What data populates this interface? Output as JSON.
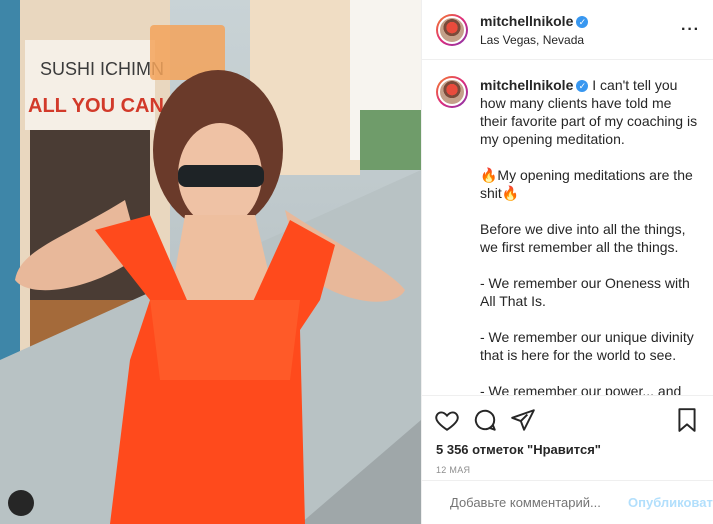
{
  "post": {
    "username": "mitchellnikole",
    "location": "Las Vegas, Nevada",
    "caption": "I can't tell you how many clients have told me their favorite part of my coaching is my opening meditation.\n\n🔥My opening meditations are the shit🔥\n\nBefore we dive into all the things, we first remember all the things.\n\n- We remember our Oneness with All That Is.\n\n- We remember our unique divinity that is here for the world to see.\n\n- We remember our power... and how we have the power to create any reality we want.",
    "likes": "5 356 отметок \"Нравится\"",
    "date": "12 МАЯ"
  },
  "photo": {
    "sign_line1": "SUSHI ICHIMN",
    "sign_line2": "ALL YOU CAN EAT"
  },
  "comment": {
    "placeholder": "Добавьте комментарий...",
    "publish": "Опубликовать"
  }
}
